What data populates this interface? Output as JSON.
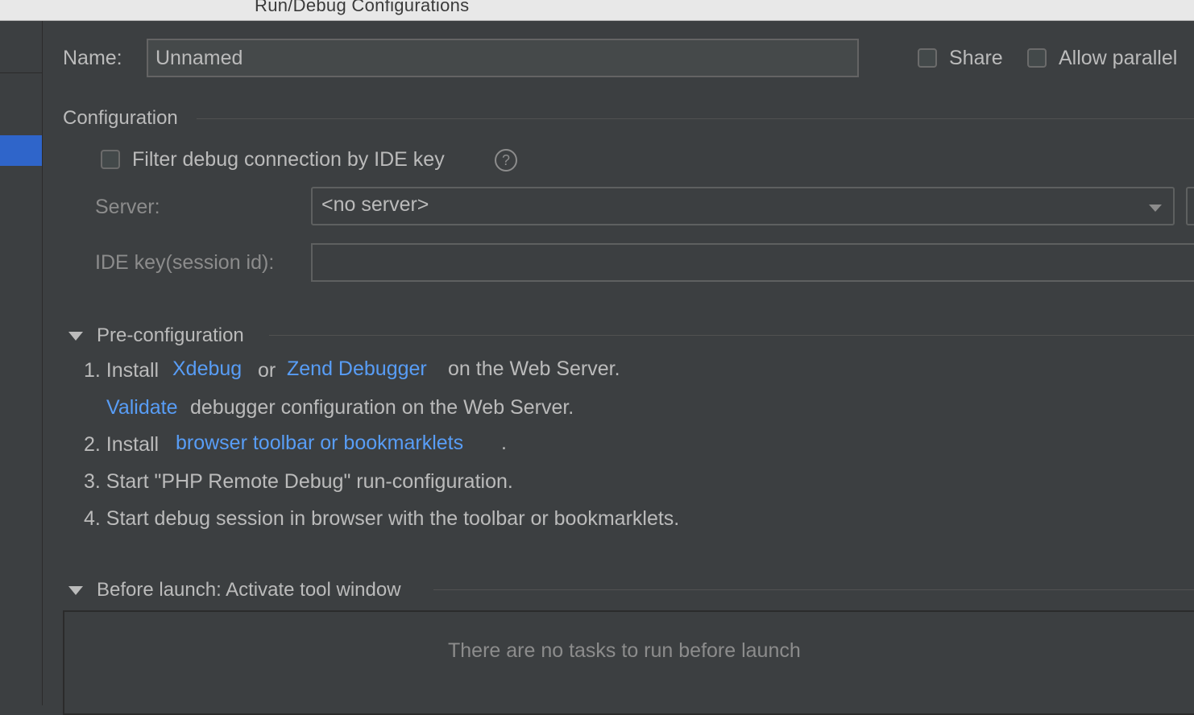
{
  "window": {
    "title": "Run/Debug Configurations"
  },
  "name_row": {
    "label": "Name:",
    "value": "Unnamed",
    "share_label": "Share",
    "share_checked": false,
    "allow_parallel_label": "Allow parallel",
    "allow_parallel_checked": false
  },
  "configuration": {
    "section_title": "Configuration",
    "filter_label": "Filter debug connection by IDE key",
    "filter_checked": false,
    "help_glyph": "?",
    "server_label": "Server:",
    "server_value": "<no server>",
    "ide_key_label": "IDE key(session id):",
    "ide_key_value": ""
  },
  "pre_configuration": {
    "section_title": "Pre-configuration",
    "step1_prefix": "1. Install",
    "step1_link_xdebug": "Xdebug",
    "step1_or": "or",
    "step1_link_zend": "Zend Debugger",
    "step1_suffix": "on the Web Server.",
    "validate_link": "Validate",
    "validate_suffix": "debugger configuration on the Web Server.",
    "step2_prefix": "2. Install",
    "step2_link": "browser toolbar or bookmarklets",
    "step2_suffix": ".",
    "step3": "3. Start \"PHP Remote Debug\" run-configuration.",
    "step4": "4. Start debug session in browser with the toolbar or bookmarklets."
  },
  "before_launch": {
    "section_title": "Before launch: Activate tool window",
    "empty_message": "There are no tasks to run before launch"
  },
  "colors": {
    "background": "#3c3f41",
    "link": "#589df6",
    "selection": "#2f65ca"
  }
}
